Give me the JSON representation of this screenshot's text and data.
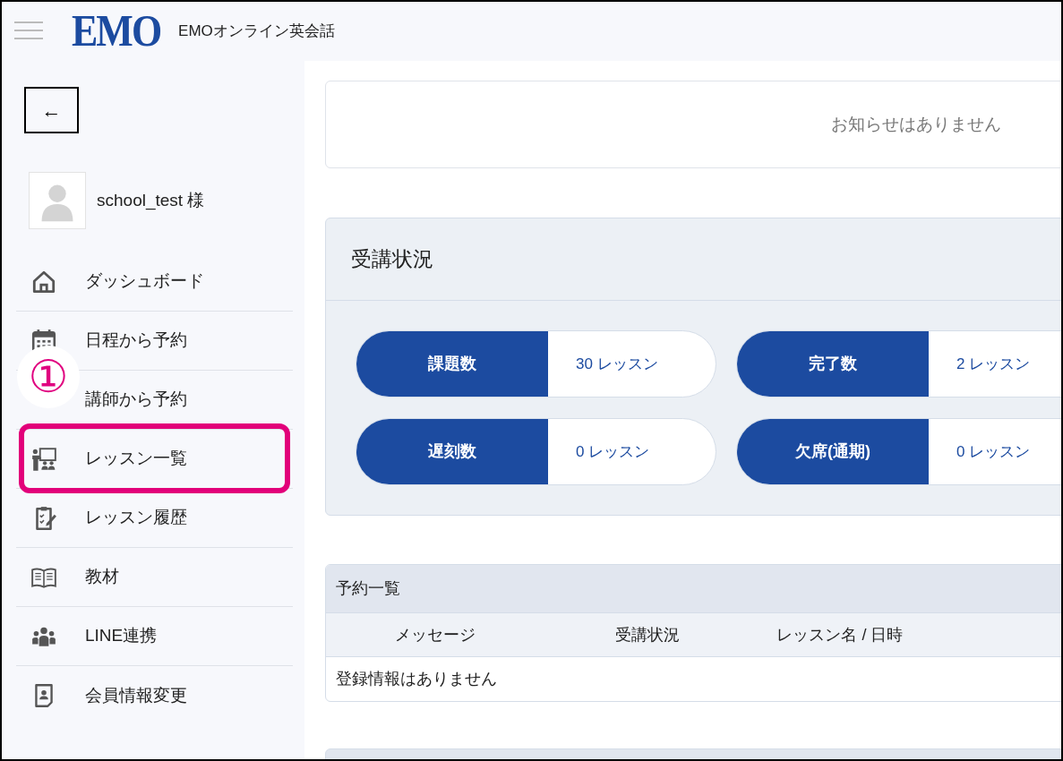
{
  "header": {
    "logo": "EMO",
    "site_title": "EMOオンライン英会話"
  },
  "sidebar": {
    "back_button": "←",
    "user_name": "school_test 様",
    "items": [
      {
        "label": "ダッシュボード",
        "highlighted": false
      },
      {
        "label": "日程から予約",
        "highlighted": false
      },
      {
        "label": "講師から予約",
        "highlighted": false
      },
      {
        "label": "レッスン一覧",
        "highlighted": true
      },
      {
        "label": "レッスン履歴",
        "highlighted": false
      },
      {
        "label": "教材",
        "highlighted": false
      },
      {
        "label": "LINE連携",
        "highlighted": false
      },
      {
        "label": "会員情報変更",
        "highlighted": false
      }
    ],
    "callout": {
      "text": "①"
    }
  },
  "notice": {
    "text": "お知らせはありません"
  },
  "status": {
    "title": "受講状況",
    "stats": [
      {
        "label": "課題数",
        "value": "30 レッスン"
      },
      {
        "label": "完了数",
        "value": "2 レッスン"
      },
      {
        "label": "遅刻数",
        "value": "0 レッスン"
      },
      {
        "label": "欠席(通期)",
        "value": "0 レッスン"
      }
    ]
  },
  "reservations": {
    "title": "予約一覧",
    "columns": [
      "メッセージ",
      "受講状況",
      "レッスン名 / 日時"
    ],
    "empty_text": "登録情報はありません"
  }
}
